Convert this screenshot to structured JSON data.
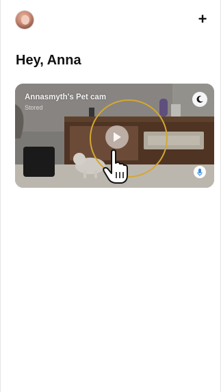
{
  "header": {
    "avatar_icon": "user-avatar-icon",
    "add_icon": "plus-icon",
    "add_label": "+"
  },
  "greeting": "Hey, Anna",
  "camera_card": {
    "title": "Annasmyth's Pet cam",
    "subtitle": "Stored",
    "night_mode_icon": "moon-icon",
    "mic_icon": "microphone-icon",
    "play_icon": "play-icon"
  },
  "overlay": {
    "cursor_icon": "hand-pointer-icon",
    "highlight_color": "#d4a830"
  },
  "colors": {
    "background": "#ffffff",
    "text": "#111111",
    "highlight": "#d4a830"
  }
}
